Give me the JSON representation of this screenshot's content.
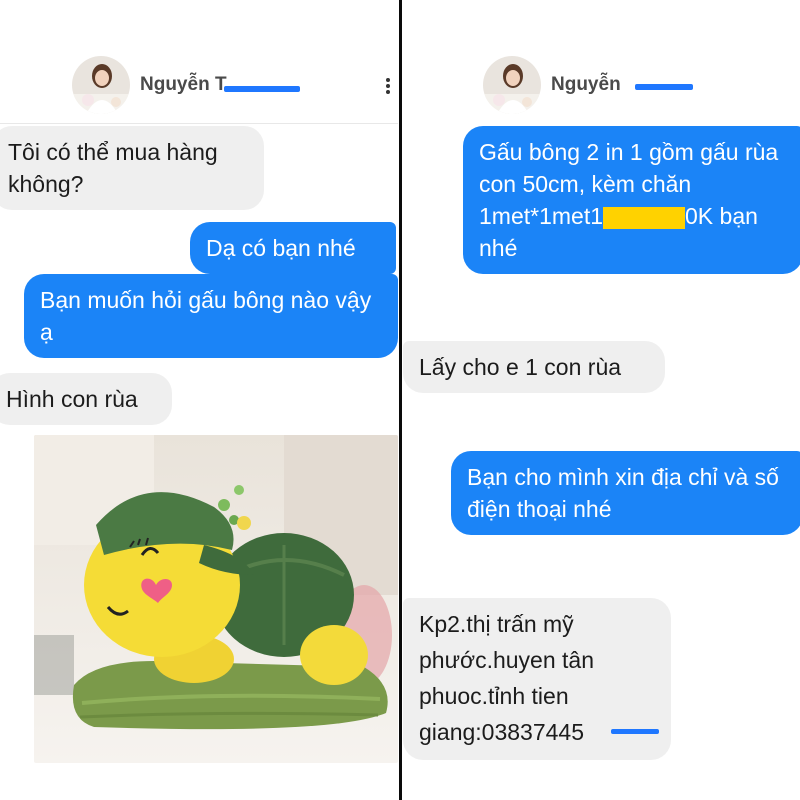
{
  "left_chat": {
    "contact_name": "Nguyễn T",
    "messages": [
      {
        "direction": "incoming",
        "text": "Tôi có thể mua hàng không?"
      },
      {
        "direction": "outgoing",
        "text": "Dạ có bạn nhé"
      },
      {
        "direction": "outgoing",
        "text": "Bạn muốn hỏi gấu bông nào vậy ạ"
      },
      {
        "direction": "incoming",
        "text": "Hình con rùa"
      }
    ],
    "photo_icon": "turtle-plush-photo"
  },
  "right_chat": {
    "contact_name": "Nguyễn",
    "messages": [
      {
        "direction": "outgoing",
        "text_before": "Gấu bông 2 in 1 gồm gấu rùa con 50cm, kèm chăn 1met*1met1",
        "text_after": "0K bạn nhé"
      },
      {
        "direction": "incoming",
        "text": "Lấy cho e 1 con rùa"
      },
      {
        "direction": "outgoing",
        "text": "Bạn cho mình xin địa chỉ và số điện thoại nhé"
      },
      {
        "direction": "incoming",
        "text": "Kp2.thị trấn mỹ phước.huyen tân phuoc.tỉnh tien giang:03837445"
      }
    ]
  },
  "icons": [
    "avatar-photo",
    "more-options-icon"
  ],
  "colors": {
    "outgoing_bubble": "#1b84f7",
    "incoming_bubble": "#efefef",
    "redaction_blue": "#1f77ff",
    "redaction_yellow": "#ffd200"
  }
}
